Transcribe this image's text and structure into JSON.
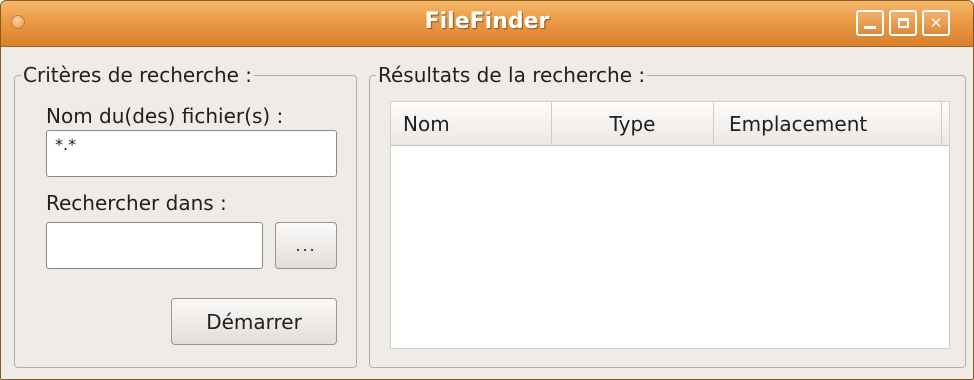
{
  "window": {
    "title": "FileFinder"
  },
  "search_criteria": {
    "group_title": "Critères de recherche :",
    "filename_label": "Nom du(des) fichier(s) :",
    "filename_value": "*.*",
    "search_in_label": "Rechercher dans :",
    "search_in_value": "",
    "browse_label": "...",
    "start_label": "Démarrer"
  },
  "results": {
    "group_title": "Résultats de la recherche :",
    "columns": [
      "Nom",
      "Type",
      "Emplacement"
    ],
    "rows": []
  },
  "icons": {
    "window_menu": "circle-icon",
    "minimize": "minimize-icon",
    "maximize": "maximize-icon",
    "close": "close-icon"
  },
  "colors": {
    "titlebar": "#e8923e",
    "window_bg": "#efebe7"
  }
}
